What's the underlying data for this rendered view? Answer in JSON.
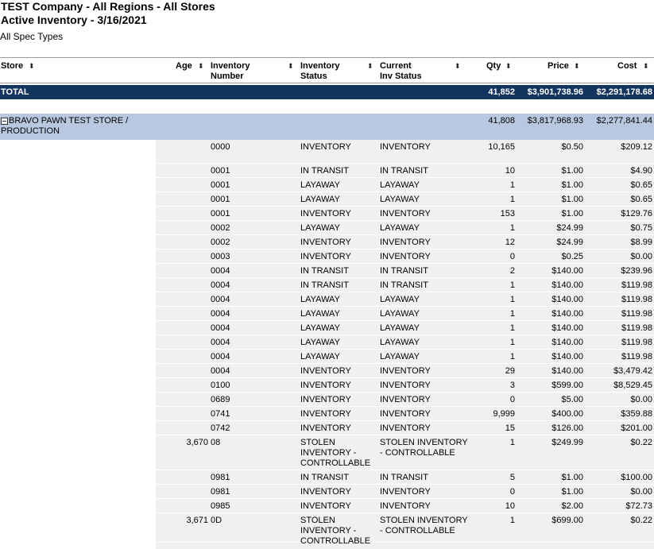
{
  "report": {
    "title_line1": "TEST Company - All Regions - All Stores",
    "title_line2": "Active Inventory - 3/16/2021",
    "subtitle": "All Spec Types"
  },
  "columns": {
    "store": "Store",
    "age": "Age",
    "inventory_number_l1": "Inventory",
    "inventory_number_l2": "Number",
    "inventory_status_l1": "Inventory",
    "inventory_status_l2": "Status",
    "current_status_l1": "Current",
    "current_status_l2": "Inv Status",
    "qty": "Qty",
    "price": "Price",
    "cost": "Cost",
    "sort_icon": "⬍"
  },
  "total": {
    "label": "TOTAL",
    "qty": "41,852",
    "price": "$3,901,738.96",
    "cost": "$2,291,178.68"
  },
  "group": {
    "store_l1": "BRAVO PAWN TEST STORE /",
    "store_l2": "PRODUCTION",
    "qty": "41,808",
    "price": "$3,817,968.93",
    "cost": "$2,277,841.44"
  },
  "rows": [
    {
      "age": "",
      "number": "0000",
      "status": [
        "INVENTORY"
      ],
      "current": [
        "INVENTORY"
      ],
      "qty": "10,165",
      "price": "$0.50",
      "cost": "$209.12"
    },
    {
      "age": "",
      "number": "0001",
      "status": [
        "IN TRANSIT"
      ],
      "current": [
        "IN TRANSIT"
      ],
      "qty": "10",
      "price": "$1.00",
      "cost": "$4.90"
    },
    {
      "age": "",
      "number": "0001",
      "status": [
        "LAYAWAY"
      ],
      "current": [
        "LAYAWAY"
      ],
      "qty": "1",
      "price": "$1.00",
      "cost": "$0.65"
    },
    {
      "age": "",
      "number": "0001",
      "status": [
        "LAYAWAY"
      ],
      "current": [
        "LAYAWAY"
      ],
      "qty": "1",
      "price": "$1.00",
      "cost": "$0.65"
    },
    {
      "age": "",
      "number": "0001",
      "status": [
        "INVENTORY"
      ],
      "current": [
        "INVENTORY"
      ],
      "qty": "153",
      "price": "$1.00",
      "cost": "$129.76"
    },
    {
      "age": "",
      "number": "0002",
      "status": [
        "LAYAWAY"
      ],
      "current": [
        "LAYAWAY"
      ],
      "qty": "1",
      "price": "$24.99",
      "cost": "$0.75"
    },
    {
      "age": "",
      "number": "0002",
      "status": [
        "INVENTORY"
      ],
      "current": [
        "INVENTORY"
      ],
      "qty": "12",
      "price": "$24.99",
      "cost": "$8.99"
    },
    {
      "age": "",
      "number": "0003",
      "status": [
        "INVENTORY"
      ],
      "current": [
        "INVENTORY"
      ],
      "qty": "0",
      "price": "$0.25",
      "cost": "$0.00"
    },
    {
      "age": "",
      "number": "0004",
      "status": [
        "IN TRANSIT"
      ],
      "current": [
        "IN TRANSIT"
      ],
      "qty": "2",
      "price": "$140.00",
      "cost": "$239.96"
    },
    {
      "age": "",
      "number": "0004",
      "status": [
        "IN TRANSIT"
      ],
      "current": [
        "IN TRANSIT"
      ],
      "qty": "1",
      "price": "$140.00",
      "cost": "$119.98"
    },
    {
      "age": "",
      "number": "0004",
      "status": [
        "LAYAWAY"
      ],
      "current": [
        "LAYAWAY"
      ],
      "qty": "1",
      "price": "$140.00",
      "cost": "$119.98"
    },
    {
      "age": "",
      "number": "0004",
      "status": [
        "LAYAWAY"
      ],
      "current": [
        "LAYAWAY"
      ],
      "qty": "1",
      "price": "$140.00",
      "cost": "$119.98"
    },
    {
      "age": "",
      "number": "0004",
      "status": [
        "LAYAWAY"
      ],
      "current": [
        "LAYAWAY"
      ],
      "qty": "1",
      "price": "$140.00",
      "cost": "$119.98"
    },
    {
      "age": "",
      "number": "0004",
      "status": [
        "LAYAWAY"
      ],
      "current": [
        "LAYAWAY"
      ],
      "qty": "1",
      "price": "$140.00",
      "cost": "$119.98"
    },
    {
      "age": "",
      "number": "0004",
      "status": [
        "LAYAWAY"
      ],
      "current": [
        "LAYAWAY"
      ],
      "qty": "1",
      "price": "$140.00",
      "cost": "$119.98"
    },
    {
      "age": "",
      "number": "0004",
      "status": [
        "INVENTORY"
      ],
      "current": [
        "INVENTORY"
      ],
      "qty": "29",
      "price": "$140.00",
      "cost": "$3,479.42"
    },
    {
      "age": "",
      "number": "0100",
      "status": [
        "INVENTORY"
      ],
      "current": [
        "INVENTORY"
      ],
      "qty": "3",
      "price": "$599.00",
      "cost": "$8,529.45"
    },
    {
      "age": "",
      "number": "0689",
      "status": [
        "INVENTORY"
      ],
      "current": [
        "INVENTORY"
      ],
      "qty": "0",
      "price": "$5.00",
      "cost": "$0.00"
    },
    {
      "age": "",
      "number": "0741",
      "status": [
        "INVENTORY"
      ],
      "current": [
        "INVENTORY"
      ],
      "qty": "9,999",
      "price": "$400.00",
      "cost": "$359.88"
    },
    {
      "age": "",
      "number": "0742",
      "status": [
        "INVENTORY"
      ],
      "current": [
        "INVENTORY"
      ],
      "qty": "15",
      "price": "$126.00",
      "cost": "$201.00"
    },
    {
      "age": "3,670",
      "number": "08",
      "status": [
        "STOLEN",
        "INVENTORY -",
        "CONTROLLABLE"
      ],
      "current": [
        "STOLEN INVENTORY",
        "- CONTROLLABLE"
      ],
      "qty": "1",
      "price": "$249.99",
      "cost": "$0.22"
    },
    {
      "age": "",
      "number": "0981",
      "status": [
        "IN TRANSIT"
      ],
      "current": [
        "IN TRANSIT"
      ],
      "qty": "5",
      "price": "$1.00",
      "cost": "$100.00"
    },
    {
      "age": "",
      "number": "0981",
      "status": [
        "INVENTORY"
      ],
      "current": [
        "INVENTORY"
      ],
      "qty": "0",
      "price": "$1.00",
      "cost": "$0.00"
    },
    {
      "age": "",
      "number": "0985",
      "status": [
        "INVENTORY"
      ],
      "current": [
        "INVENTORY"
      ],
      "qty": "10",
      "price": "$2.00",
      "cost": "$72.73"
    },
    {
      "age": "3,671",
      "number": "0D",
      "status": [
        "STOLEN",
        "INVENTORY -",
        "CONTROLLABLE"
      ],
      "current": [
        "STOLEN INVENTORY",
        "- CONTROLLABLE"
      ],
      "qty": "1",
      "price": "$699.00",
      "cost": "$0.22"
    }
  ]
}
